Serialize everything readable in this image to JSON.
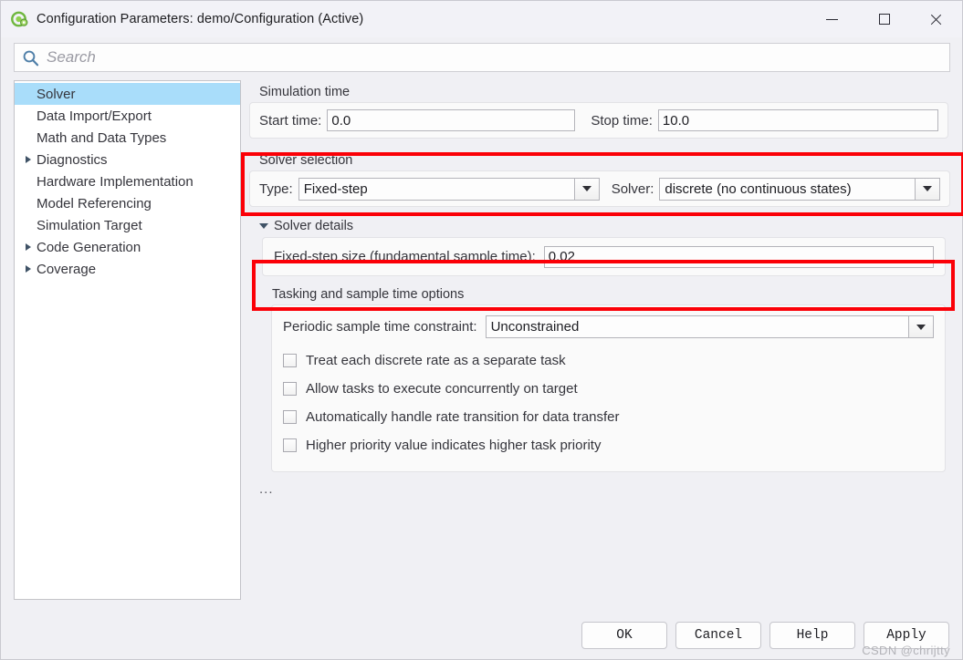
{
  "window": {
    "title": "Configuration Parameters: demo/Configuration (Active)",
    "icon": "simulink-logo-icon",
    "controls": {
      "minimize": "minimize-icon",
      "maximize": "maximize-icon",
      "close": "close-icon"
    }
  },
  "search": {
    "icon": "search-icon",
    "placeholder": "Search",
    "value": ""
  },
  "sidebar": {
    "items": [
      {
        "label": "Solver",
        "expandable": false,
        "selected": true
      },
      {
        "label": "Data Import/Export",
        "expandable": false,
        "selected": false
      },
      {
        "label": "Math and Data Types",
        "expandable": false,
        "selected": false
      },
      {
        "label": "Diagnostics",
        "expandable": true,
        "selected": false
      },
      {
        "label": "Hardware Implementation",
        "expandable": false,
        "selected": false
      },
      {
        "label": "Model Referencing",
        "expandable": false,
        "selected": false
      },
      {
        "label": "Simulation Target",
        "expandable": false,
        "selected": false
      },
      {
        "label": "Code Generation",
        "expandable": true,
        "selected": false
      },
      {
        "label": "Coverage",
        "expandable": true,
        "selected": false
      }
    ]
  },
  "main": {
    "simulation_time": {
      "title": "Simulation time",
      "start_label": "Start time:",
      "start_value": "0.0",
      "stop_label": "Stop time:",
      "stop_value": "10.0"
    },
    "solver_selection": {
      "title": "Solver selection",
      "type_label": "Type:",
      "type_value": "Fixed-step",
      "solver_label": "Solver:",
      "solver_value": "discrete (no continuous states)",
      "highlighted": true
    },
    "solver_details": {
      "title": "Solver details",
      "expanded": true,
      "fixed_step_label": "Fixed-step size (fundamental sample time):",
      "fixed_step_value": "0.02",
      "highlighted": true
    },
    "tasking": {
      "title": "Tasking and sample time options",
      "constraint_label": "Periodic sample time constraint:",
      "constraint_value": "Unconstrained",
      "checkboxes": [
        {
          "label": "Treat each discrete rate as a separate task",
          "checked": false
        },
        {
          "label": "Allow tasks to execute concurrently on target",
          "checked": false
        },
        {
          "label": "Automatically handle rate transition for data transfer",
          "checked": false
        },
        {
          "label": "Higher priority value indicates higher task priority",
          "checked": false
        }
      ]
    },
    "overflow_indicator": "..."
  },
  "footer": {
    "ok_label": "OK",
    "cancel_label": "Cancel",
    "help_label": "Help",
    "apply_label": "Apply"
  },
  "watermark": {
    "text": "CSDN @chrijtty"
  },
  "colors": {
    "highlight_red": "#fb0007",
    "selection_blue": "#a9ddfa",
    "search_icon_blue": "#4f7fa8",
    "logo_green": "#79c143"
  }
}
